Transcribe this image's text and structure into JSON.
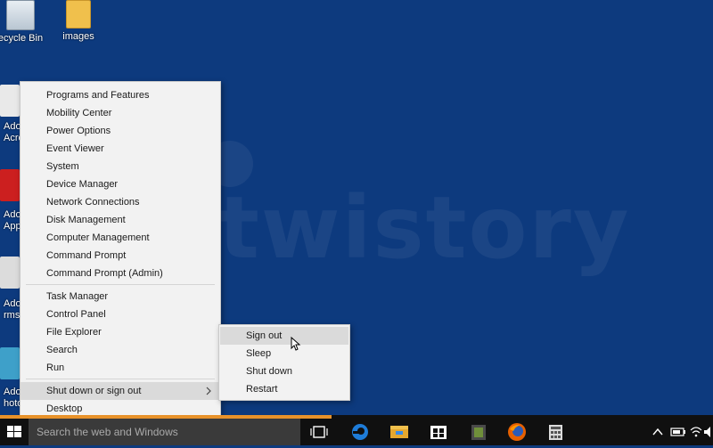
{
  "desktop": {
    "icons": [
      {
        "label": "ecycle Bin"
      },
      {
        "label": "images"
      }
    ],
    "partial_labels": [
      "Ado",
      "Acrob",
      "Ado",
      "Appli",
      "Ado",
      "rmsC",
      "Ado",
      "hotos"
    ]
  },
  "watermark": "twistory",
  "context_menu": {
    "group1": [
      "Programs and Features",
      "Mobility Center",
      "Power Options",
      "Event Viewer",
      "System",
      "Device Manager",
      "Network Connections",
      "Disk Management",
      "Computer Management",
      "Command Prompt",
      "Command Prompt (Admin)"
    ],
    "group2": [
      "Task Manager",
      "Control Panel",
      "File Explorer",
      "Search",
      "Run"
    ],
    "shutdown_item": "Shut down or sign out",
    "desktop_item": "Desktop"
  },
  "submenu": {
    "items": [
      "Sign out",
      "Sleep",
      "Shut down",
      "Restart"
    ],
    "highlighted": "Sign out"
  },
  "taskbar": {
    "search_placeholder": "Search the web and Windows",
    "pinned": [
      "task-view-icon",
      "edge-icon",
      "file-explorer-icon",
      "store-icon",
      "app-icon",
      "firefox-icon",
      "calculator-icon"
    ],
    "accent_color": "#e8922a"
  },
  "colors": {
    "desktop_bg": "#0d3a7e",
    "menu_bg": "#f2f2f2",
    "highlight": "#dadada"
  }
}
